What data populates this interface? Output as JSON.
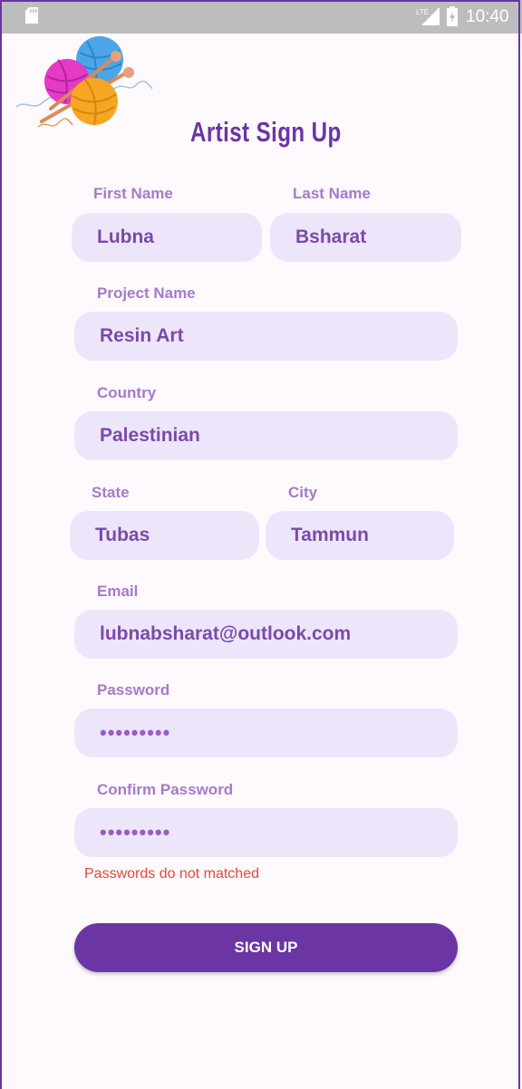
{
  "status_bar": {
    "network": "LTE",
    "time": "10:40"
  },
  "header": {
    "title": "Artist Sign Up"
  },
  "form": {
    "first_name": {
      "label": "First Name",
      "value": "Lubna"
    },
    "last_name": {
      "label": "Last Name",
      "value": "Bsharat"
    },
    "project_name": {
      "label": "Project Name",
      "value": "Resin Art"
    },
    "country": {
      "label": "Country",
      "value": "Palestinian"
    },
    "state": {
      "label": "State",
      "value": "Tubas"
    },
    "city": {
      "label": "City",
      "value": "Tammun"
    },
    "email": {
      "label": "Email",
      "value": "lubnabsharat@outlook.com"
    },
    "password": {
      "label": "Password",
      "value": "•••••••••"
    },
    "confirm_password": {
      "label": "Confirm Password",
      "value": "•••••••••"
    },
    "error": "Passwords do not matched",
    "submit_label": "SIGN UP"
  },
  "colors": {
    "accent": "#6b35a4",
    "field_bg": "#ede6fb",
    "label": "#a57bc7",
    "error": "#e04a3a"
  },
  "icons": [
    "sd-card-icon",
    "lte-signal-icon",
    "battery-charging-icon",
    "yarn-logo"
  ]
}
